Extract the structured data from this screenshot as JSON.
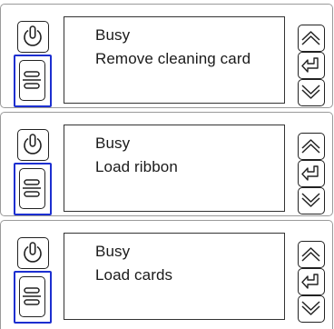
{
  "panels": [
    {
      "status": "Busy",
      "message": "Remove cleaning card"
    },
    {
      "status": "Busy",
      "message": "Load ribbon"
    },
    {
      "status": "Busy",
      "message": "Load cards"
    }
  ],
  "icons": {
    "power": "power-icon",
    "menu": "menu-icon",
    "up": "chevron-up-icon",
    "enter": "enter-icon",
    "down": "chevron-down-icon"
  },
  "colors": {
    "highlight": "#1c2fd0",
    "outline": "#222222",
    "panel_border": "#9a9a9a"
  }
}
